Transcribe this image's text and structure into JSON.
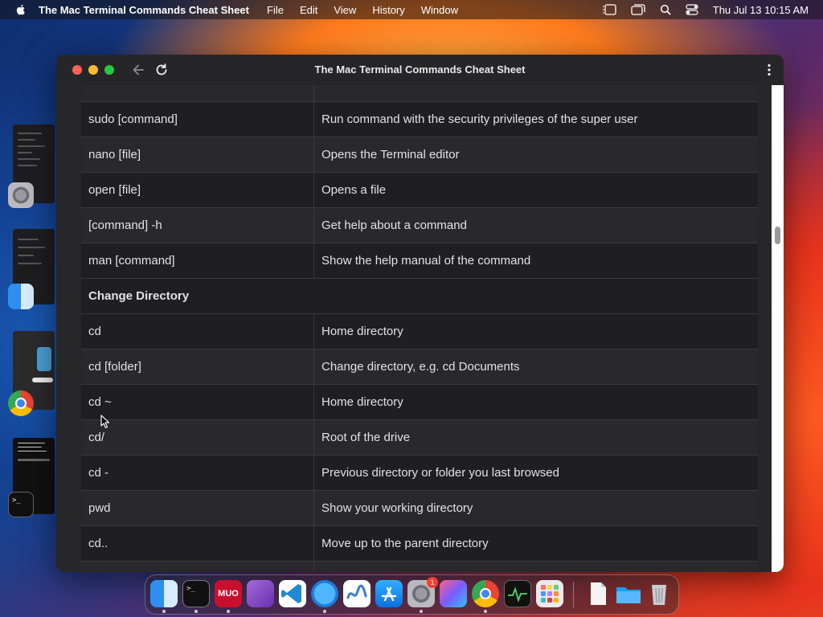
{
  "menubar": {
    "app_name": "The Mac Terminal Commands Cheat Sheet",
    "menus": [
      "File",
      "Edit",
      "View",
      "History",
      "Window"
    ],
    "datetime": "Thu Jul 13  10:15 AM"
  },
  "window": {
    "title": "The Mac Terminal Commands Cheat Sheet"
  },
  "table": {
    "rows": [
      {
        "command": "sudo [command]",
        "description": "Run command with the security privileges of the super user"
      },
      {
        "command": "nano [file]",
        "description": "Opens the Terminal editor"
      },
      {
        "command": "open [file]",
        "description": "Opens a file"
      },
      {
        "command": "[command] -h",
        "description": "Get help about a command"
      },
      {
        "command": "man [command]",
        "description": "Show the help manual of the command"
      },
      {
        "section": "Change Directory"
      },
      {
        "command": "cd",
        "description": "Home directory"
      },
      {
        "command": "cd [folder]",
        "description": "Change directory, e.g. cd Documents"
      },
      {
        "command": "cd ~",
        "description": "Home directory"
      },
      {
        "command": "cd/",
        "description": "Root of the drive"
      },
      {
        "command": "cd -",
        "description": "Previous directory or folder you last browsed"
      },
      {
        "command": "pwd",
        "description": "Show your working directory"
      },
      {
        "command": "cd..",
        "description": "Move up to the parent directory"
      }
    ]
  },
  "dock": {
    "muo_label": "MUO",
    "settings_badge": "1"
  },
  "colors": {
    "close": "#ff5f57",
    "minimize": "#febc2e",
    "zoom": "#28c840"
  }
}
